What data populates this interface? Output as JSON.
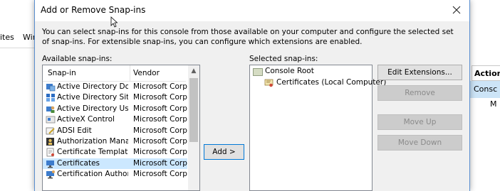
{
  "background": {
    "menu_items": [
      "ites",
      "Win"
    ],
    "actions_header": "Action",
    "actions_row": "Consc",
    "actions_row2": "M"
  },
  "dialog": {
    "title": "Add or Remove Snap-ins",
    "description": "You can select snap-ins for this console from those available on your computer and configure the selected set of snap-ins. For extensible snap-ins, you can configure which extensions are enabled.",
    "available_label": "Available snap-ins:",
    "selected_label": "Selected snap-ins:",
    "columns": {
      "snapin": "Snap-in",
      "vendor": "Vendor"
    },
    "available": [
      {
        "name": "Active Directory Dom...",
        "vendor": "Microsoft Corp...",
        "icon": "ad-domains-icon"
      },
      {
        "name": "Active Directory Sites...",
        "vendor": "Microsoft Corp...",
        "icon": "ad-sites-icon"
      },
      {
        "name": "Active Directory User...",
        "vendor": "Microsoft Corp...",
        "icon": "ad-users-icon"
      },
      {
        "name": "ActiveX Control",
        "vendor": "Microsoft Corp...",
        "icon": "activex-icon"
      },
      {
        "name": "ADSI Edit",
        "vendor": "Microsoft Corp...",
        "icon": "adsi-edit-icon"
      },
      {
        "name": "Authorization Manager",
        "vendor": "Microsoft Corp...",
        "icon": "authorization-icon"
      },
      {
        "name": "Certificate Templates",
        "vendor": "Microsoft Corp...",
        "icon": "cert-templates-icon"
      },
      {
        "name": "Certificates",
        "vendor": "Microsoft Corp...",
        "icon": "certificates-icon",
        "selected": true
      },
      {
        "name": "Certification Authority",
        "vendor": "Microsoft Corp...",
        "icon": "cert-authority-icon"
      }
    ],
    "add_button": "Add >",
    "selected_tree": {
      "root": "Console Root",
      "child": "Certificates (Local Computer)"
    },
    "buttons": {
      "edit_extensions": "Edit Extensions...",
      "remove": "Remove",
      "move_up": "Move Up",
      "move_down": "Move Down"
    }
  },
  "colors": {
    "accent": "#0078d7",
    "selection": "#cce8ff",
    "dialog_bg": "#f0f0f0"
  }
}
